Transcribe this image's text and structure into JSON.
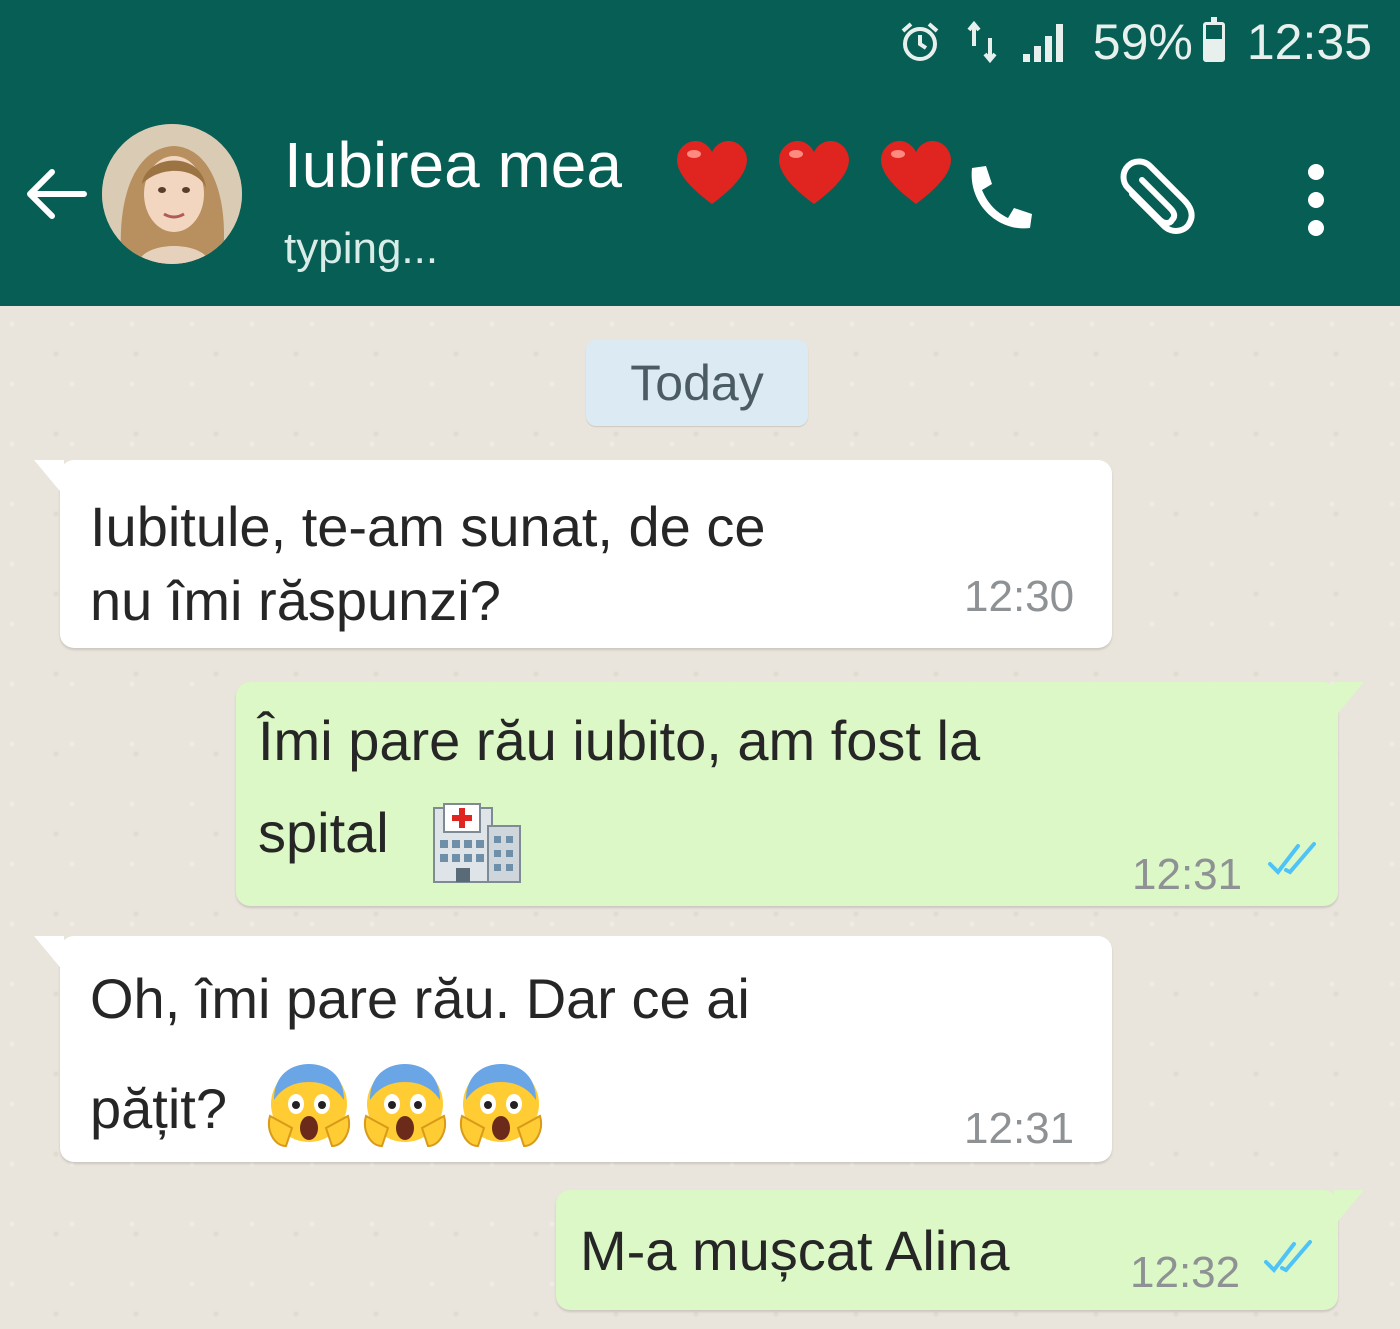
{
  "status_bar": {
    "alarm_icon": "alarm-clock-icon",
    "data_icon": "data-arrows-icon",
    "signal_icon": "signal-bars-icon",
    "battery_percent": "59%",
    "battery_level": 0.59,
    "time": "12:35"
  },
  "header": {
    "back_icon": "back-arrow-icon",
    "contact_name": "Iubirea mea",
    "name_emoji": [
      "red-heart-emoji",
      "red-heart-emoji",
      "red-heart-emoji"
    ],
    "status": "typing...",
    "actions": [
      "phone-call-icon",
      "paperclip-icon",
      "more-vertical-icon"
    ],
    "bg_color": "#075e54"
  },
  "chat": {
    "date_label": "Today",
    "messages": [
      {
        "direction": "incoming",
        "text": "Iubitule, te-am sunat, de ce\nnu îmi răspunzi?",
        "time": "12:30"
      },
      {
        "direction": "outgoing",
        "text_line1": "Îmi pare rău iubito, am fost la",
        "text_line2": "spital",
        "emoji": [
          "hospital-emoji"
        ],
        "time": "12:31",
        "status": "read"
      },
      {
        "direction": "incoming",
        "text_line1": "Oh, îmi pare rău. Dar ce ai",
        "text_line2": "pățit?",
        "emoji": [
          "screaming-face-emoji",
          "screaming-face-emoji",
          "screaming-face-emoji"
        ],
        "time": "12:31"
      },
      {
        "direction": "outgoing",
        "text": "M-a mușcat Alina",
        "time": "12:32",
        "status": "read"
      }
    ],
    "colors": {
      "incoming": "#ffffff",
      "outgoing": "#dcf8c6",
      "read_ticks": "#4fc3f7"
    }
  }
}
